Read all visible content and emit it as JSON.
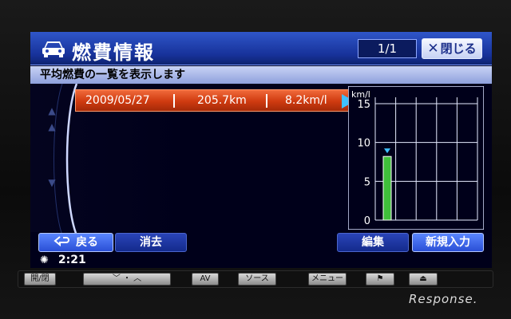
{
  "header": {
    "title": "燃費情報",
    "page_indicator": "1/1",
    "close_label": "閉じる"
  },
  "subtitle": "平均燃費の一覧を表示します",
  "records": [
    {
      "date": "2009/05/27",
      "distance": "205.7km",
      "fuel_economy": "8.2km/l"
    }
  ],
  "chart_data": {
    "type": "bar",
    "ylabel": "km/l",
    "ylim": [
      0,
      15
    ],
    "yticks": [
      "15",
      "10",
      "5",
      "0"
    ],
    "categories": [
      "2009/05/27"
    ],
    "values": [
      8.2
    ],
    "bar_color": "#3fc03a",
    "marker_color": "#3fc0ff"
  },
  "buttons": {
    "back": "戻る",
    "delete": "消去",
    "edit": "編集",
    "new_entry": "新規入力"
  },
  "status": {
    "time": "2:21",
    "icon": "sun-icon"
  },
  "hardware": {
    "open_close": "開/閉",
    "av": "AV",
    "source": "ソース",
    "menu": "メニュー"
  },
  "watermark": "Response."
}
